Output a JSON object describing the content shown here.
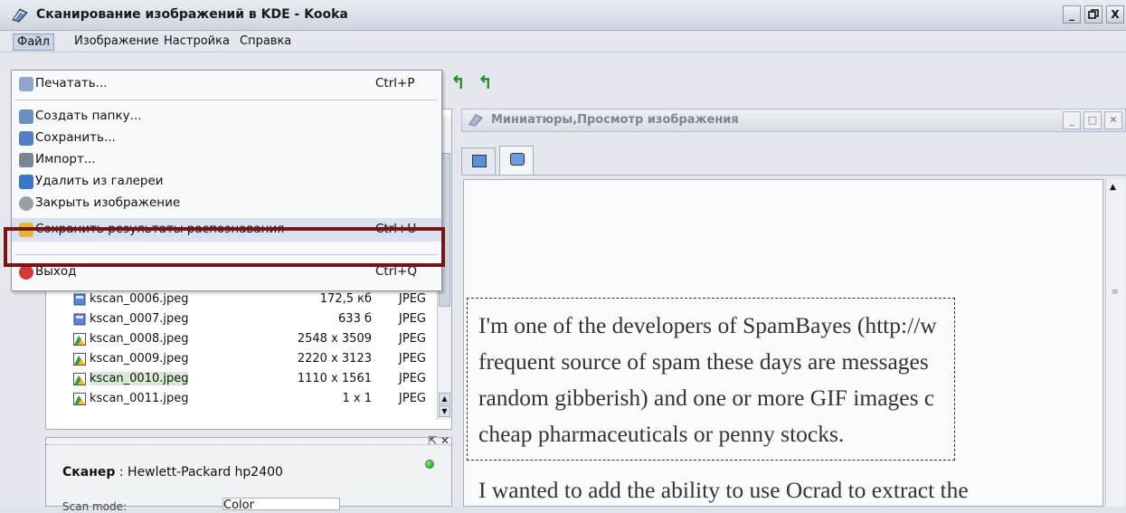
{
  "window": {
    "title": "Сканирование изображений в KDE - Kooka",
    "controls": {
      "minimize": "_",
      "maximize": "Ɖ",
      "close": "X"
    }
  },
  "menubar": {
    "items": [
      {
        "label": "Файл"
      },
      {
        "label": "Изображение"
      },
      {
        "label": "Настройка"
      },
      {
        "label": "Справка"
      }
    ]
  },
  "file_menu": {
    "items": [
      {
        "label": "Печатать...",
        "shortcut": "Ctrl+P",
        "icon": "printer-icon"
      },
      {
        "label": "Создать папку...",
        "shortcut": "",
        "icon": "folder-new-icon"
      },
      {
        "label": "Сохранить...",
        "shortcut": "",
        "icon": "save-icon"
      },
      {
        "label": "Импорт...",
        "shortcut": "",
        "icon": "import-icon"
      },
      {
        "label": "Удалить из галереи",
        "shortcut": "",
        "icon": "trash-icon"
      },
      {
        "label": "Закрыть изображение",
        "shortcut": "",
        "icon": "close-image-icon"
      },
      {
        "label": "Сохранить результаты распознавания",
        "shortcut": "Ctrl+U",
        "icon": "save-ocr-icon"
      },
      {
        "label": "Выход",
        "shortcut": "Ctrl+Q",
        "icon": "exit-icon"
      }
    ]
  },
  "gallery": {
    "rows": [
      {
        "name": "kscan_0006.jpeg",
        "size": "172,5 кб",
        "type": "JPEG",
        "icon": "file-icon"
      },
      {
        "name": "kscan_0007.jpeg",
        "size": "633 б",
        "type": "JPEG",
        "icon": "file-icon"
      },
      {
        "name": "kscan_0008.jpeg",
        "size": "2548 x 3509",
        "type": "JPEG",
        "icon": "image-icon"
      },
      {
        "name": "kscan_0009.jpeg",
        "size": "2220 x 3123",
        "type": "JPEG",
        "icon": "image-icon"
      },
      {
        "name": "kscan_0010.jpeg",
        "size": "1110 x 1561",
        "type": "JPEG",
        "icon": "image-icon"
      },
      {
        "name": "kscan_0011.jpeg",
        "size": "1 x 1",
        "type": "JPEG",
        "icon": "image-icon"
      }
    ],
    "highlighted_row": 4
  },
  "scanner": {
    "label": "Сканер",
    "device": " : Hewlett-Packard hp2400",
    "mode_label": "Scan mode:",
    "mode_value": "Color",
    "status_color": "#2a9a2a"
  },
  "viewer": {
    "panel_title": "Миниатюры,Просмотр изображения",
    "text_lines": [
      "I'm one of the developers of SpamBayes (http://w",
      "frequent source of spam these days are messages",
      "random gibberish) and one or more GIF images c",
      "cheap pharmaceuticals or penny stocks.",
      "I wanted to add the ability to use Ocrad to extract the"
    ]
  },
  "colors": {
    "highlight_box": "#7a1414",
    "menu_highlight": "#d7e1f0",
    "toolbar_arrow": "#2a8a2a"
  }
}
